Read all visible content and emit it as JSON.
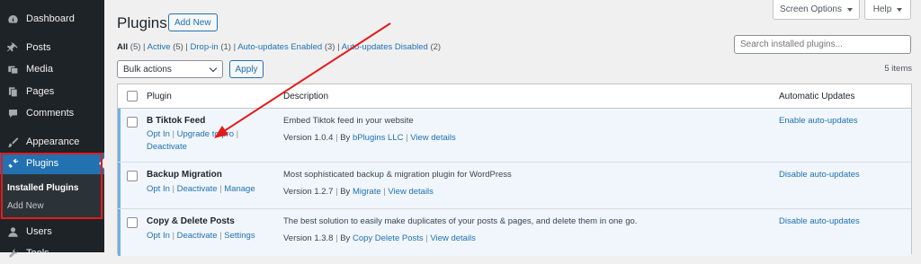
{
  "sidebar": {
    "items": [
      {
        "label": "Dashboard",
        "icon": "dashboard-icon"
      },
      {
        "label": "Posts",
        "icon": "pin-icon"
      },
      {
        "label": "Media",
        "icon": "media-icon"
      },
      {
        "label": "Pages",
        "icon": "pages-icon"
      },
      {
        "label": "Comments",
        "icon": "comment-icon"
      },
      {
        "label": "Appearance",
        "icon": "brush-icon"
      },
      {
        "label": "Plugins",
        "icon": "plugin-icon"
      },
      {
        "label": "Users",
        "icon": "users-icon"
      },
      {
        "label": "Tools",
        "icon": "tools-icon"
      }
    ],
    "submenu": [
      "Installed Plugins",
      "Add New"
    ]
  },
  "top_buttons": {
    "screen_options": "Screen Options",
    "help": "Help"
  },
  "header": {
    "title": "Plugins",
    "add_new": "Add New"
  },
  "filters": [
    {
      "label": "All",
      "count": "(5)"
    },
    {
      "label": "Active",
      "count": "(5)"
    },
    {
      "label": "Drop-in",
      "count": "(1)"
    },
    {
      "label": "Auto-updates Enabled",
      "count": "(3)"
    },
    {
      "label": "Auto-updates Disabled",
      "count": "(2)"
    }
  ],
  "search": {
    "placeholder": "Search installed plugins..."
  },
  "bulk": {
    "selected": "Bulk actions",
    "apply": "Apply",
    "items_count": "5 items"
  },
  "table": {
    "headers": {
      "plugin": "Plugin",
      "description": "Description",
      "auto": "Automatic Updates"
    },
    "rows": [
      {
        "name": "B Tiktok Feed",
        "actions": [
          "Opt In",
          "Upgrade to pro",
          "Deactivate"
        ],
        "description": "Embed Tiktok feed in your website",
        "version": "Version 1.0.4",
        "by_prefix": "By",
        "author": "bPlugins LLC",
        "details": "View details",
        "auto": "Enable auto-updates"
      },
      {
        "name": "Backup Migration",
        "actions": [
          "Opt In",
          "Deactivate",
          "Manage"
        ],
        "description": "Most sophisticated backup & migration plugin for WordPress",
        "version": "Version 1.2.7",
        "by_prefix": "By",
        "author": "Migrate",
        "details": "View details",
        "auto": "Disable auto-updates"
      },
      {
        "name": "Copy & Delete Posts",
        "actions": [
          "Opt In",
          "Deactivate",
          "Settings"
        ],
        "description": "The best solution to easily make duplicates of your posts & pages, and delete them in one go.",
        "version": "Version 1.3.8",
        "by_prefix": "By",
        "author": "Copy Delete Posts",
        "details": "View details",
        "auto": "Disable auto-updates"
      }
    ]
  },
  "colors": {
    "accent": "#2271b1",
    "sidebar_bg": "#1d2327",
    "annotation": "#e31b1b"
  }
}
